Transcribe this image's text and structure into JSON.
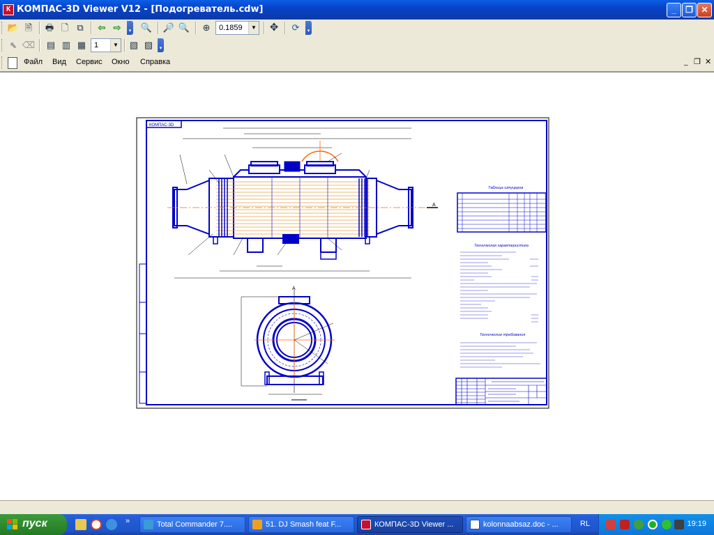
{
  "window": {
    "title": "КОМПАС-3D Viewer V12 - [Подогреватель.cdw]",
    "app_icon": "К"
  },
  "toolbar1": {
    "zoom_value": "0.1859"
  },
  "toolbar2": {
    "sheet_value": "1"
  },
  "menu": {
    "items": [
      "Файл",
      "Вид",
      "Сервис",
      "Окно",
      "Справка"
    ]
  },
  "taskbar": {
    "start_label": "пуск",
    "tasks": [
      {
        "label": "Total Commander 7...."
      },
      {
        "label": "51. DJ Smash feat F..."
      },
      {
        "label": "КОМПАС-3D Viewer ..."
      },
      {
        "label": "kolonnaabsaz.doc - ..."
      }
    ],
    "language": "RL",
    "clock": "19:19"
  },
  "drawing": {
    "stamp_title": "КОМПАС-3D",
    "table_title": "Таблица штуцеров",
    "req_title": "Технические требования",
    "char_title": "Техническая характеристика",
    "section_label": "А",
    "colors": {
      "line": "#0000c8",
      "axis": "#ff6600",
      "tubes": "#e8a040"
    }
  }
}
